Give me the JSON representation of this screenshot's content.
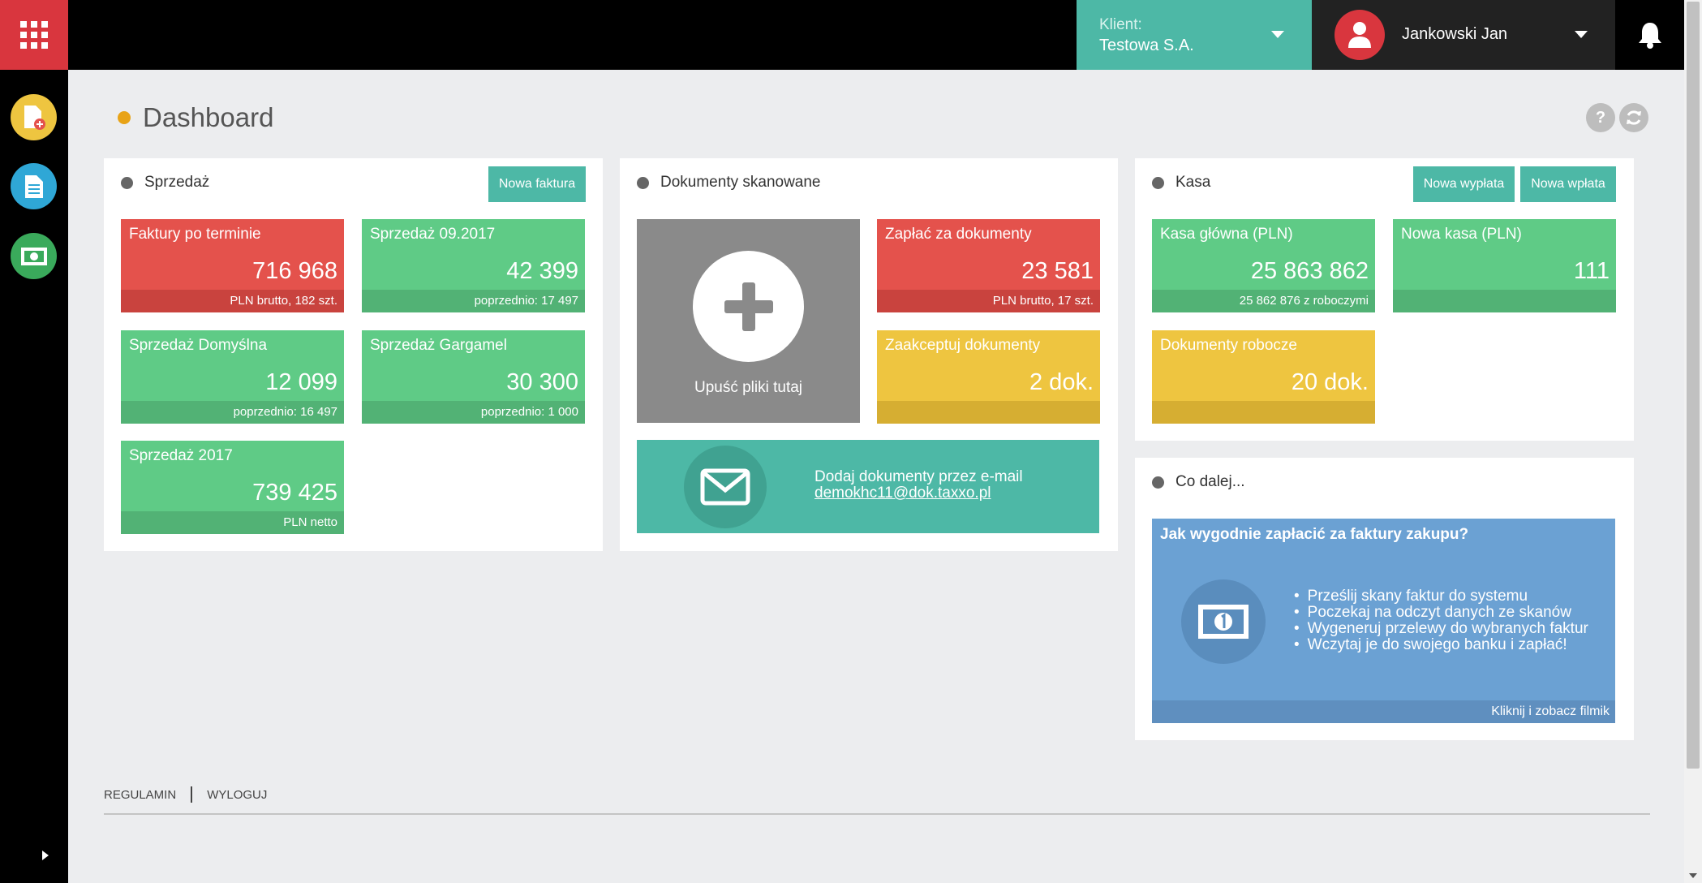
{
  "topbar": {
    "client_label": "Klient:",
    "client_value": "Testowa S.A.",
    "user_name": "Jankowski Jan"
  },
  "page": {
    "title": "Dashboard"
  },
  "sales": {
    "title": "Sprzedaż",
    "new_button": "Nowa faktura",
    "tiles": [
      {
        "label": "Faktury po terminie",
        "value": "716 968",
        "foot": "PLN brutto, 182 szt."
      },
      {
        "label": "Sprzedaż 09.2017",
        "value": "42 399",
        "foot": "poprzednio: 17 497"
      },
      {
        "label": "Sprzedaż Domyślna",
        "value": "12 099",
        "foot": "poprzednio: 16 497"
      },
      {
        "label": "Sprzedaż Gargamel",
        "value": "30 300",
        "foot": "poprzednio: 1 000"
      },
      {
        "label": "Sprzedaż 2017",
        "value": "739 425",
        "foot": "PLN netto"
      }
    ]
  },
  "scanned": {
    "title": "Dokumenty skanowane",
    "drop_label": "Upuść pliki tutaj",
    "pay_tile": {
      "label": "Zapłać za dokumenty",
      "value": "23 581",
      "foot": "PLN brutto, 17 szt."
    },
    "accept_tile": {
      "label": "Zaakceptuj dokumenty",
      "value": "2 dok."
    },
    "email_text": "Dodaj dokumenty przez e-mail",
    "email_address": "demokhc11@dok.taxxo.pl"
  },
  "cash": {
    "title": "Kasa",
    "payout_button": "Nowa wypłata",
    "payin_button": "Nowa wpłata",
    "main_tile": {
      "label": "Kasa główna (PLN)",
      "value": "25 863 862",
      "foot": "25 862 876 z roboczymi"
    },
    "new_tile": {
      "label": "Nowa kasa (PLN)",
      "value": "111"
    },
    "draft_tile": {
      "label": "Dokumenty robocze",
      "value": "20 dok."
    }
  },
  "next": {
    "title": "Co dalej...",
    "card_title": "Jak wygodnie zapłacić za faktury zakupu?",
    "items": [
      "Prześlij skany faktur do systemu",
      "Poczekaj na odczyt danych ze skanów",
      "Wygeneruj przelewy do wybranych faktur",
      "Wczytaj je do swojego banku i zapłać!"
    ],
    "card_link": "Kliknij i zobacz filmik"
  },
  "footer": {
    "terms": "REGULAMIN",
    "logout": "WYLOGUJ"
  },
  "colors": {
    "red": "#e4524c",
    "green": "#5fcb86",
    "yellow": "#eec540",
    "teal": "#4db8a6",
    "blue": "#6ba1d3",
    "grey": "#8a8a8a",
    "orange_dot": "#e8a317"
  },
  "icons": [
    "apps-grid-icon",
    "user-icon",
    "bell-icon",
    "add-document-icon",
    "document-icon",
    "money-icon",
    "help-icon",
    "refresh-icon",
    "plus-icon",
    "envelope-icon",
    "banknote-icon"
  ]
}
